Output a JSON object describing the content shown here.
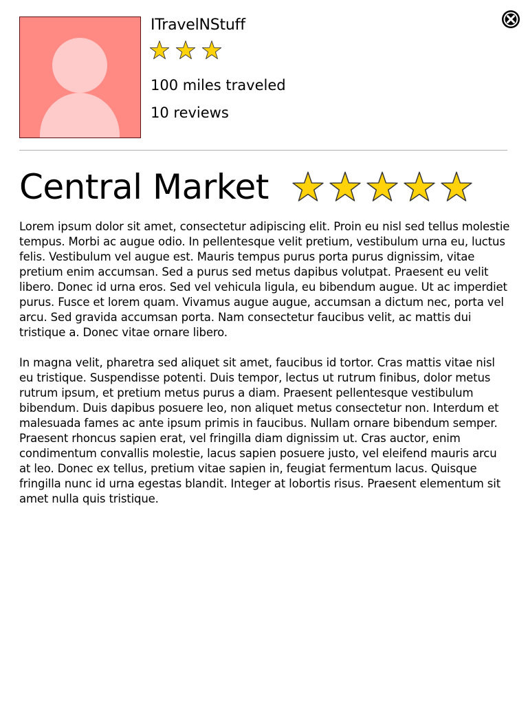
{
  "user": {
    "name": "ITravelNStuff",
    "rating": 3,
    "miles_traveled": "100 miles traveled",
    "review_count": "10 reviews",
    "avatar_color": "#ff8a84"
  },
  "place": {
    "name": "Central Market",
    "rating": 5,
    "description": [
      "Lorem ipsum dolor sit amet, consectetur adipiscing elit. Proin eu nisl sed tellus molestie tempus. Morbi ac augue odio. In pellentesque velit pretium, vestibulum urna eu, luctus felis. Vestibulum vel augue est. Mauris tempus purus porta purus dignissim, vitae pretium enim accumsan. Sed a purus sed metus dapibus volutpat. Praesent eu velit libero. Donec id urna eros. Sed vel vehicula ligula, eu bibendum augue. Ut ac imperdiet purus. Fusce et lorem quam. Vivamus augue augue, accumsan a dictum nec, porta vel arcu. Sed gravida accumsan porta. Nam consectetur faucibus velit, ac mattis dui tristique a. Donec vitae ornare libero.",
      "In magna velit, pharetra sed aliquet sit amet, faucibus id tortor. Cras mattis vitae nisl eu tristique. Suspendisse potenti. Duis tempor, lectus ut rutrum finibus, dolor metus rutrum ipsum, et pretium metus purus a diam. Praesent pellentesque vestibulum bibendum. Duis dapibus posuere leo, non aliquet metus consectetur non. Interdum et malesuada fames ac ante ipsum primis in faucibus. Nullam ornare bibendum semper. Praesent rhoncus sapien erat, vel fringilla diam dignissim ut. Cras auctor, enim condimentum convallis molestie, lacus sapien posuere justo, vel eleifend mauris arcu at leo. Donec ex tellus, pretium vitae sapien in, feugiat fermentum lacus. Quisque fringilla nunc id urna egestas blandit. Integer at lobortis risus. Praesent elementum sit amet nulla quis tristique."
    ]
  },
  "icons": {
    "close": "close-icon",
    "star": "star-icon",
    "avatar": "person-icon"
  },
  "colors": {
    "star_fill": "#ffd20a",
    "star_stroke": "#333333",
    "divider": "#b0b0b0"
  }
}
